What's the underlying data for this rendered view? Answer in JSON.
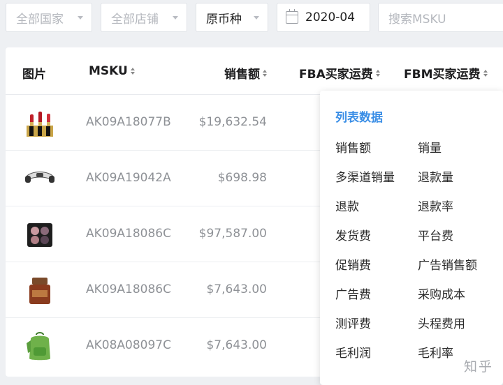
{
  "filters": {
    "country_placeholder": "全部国家",
    "store_placeholder": "全部店铺",
    "currency_value": "原币种",
    "date_value": "2020-04",
    "search_placeholder": "搜索MSKU"
  },
  "table": {
    "columns": {
      "image": "图片",
      "msku": "MSKU",
      "sales": "销售额",
      "fba_shipping": "FBA买家运费",
      "fbm_shipping": "FBM买家运费"
    },
    "rows": [
      {
        "msku": "AK09A18077B",
        "sales": "$19,632.54",
        "image_icon": "lipstick-product-icon"
      },
      {
        "msku": "AK09A19042A",
        "sales": "$698.98",
        "image_icon": "massager-product-icon"
      },
      {
        "msku": "AK09A18086C",
        "sales": "$97,587.00",
        "image_icon": "eyeshadow-product-icon"
      },
      {
        "msku": "AK09A18086C",
        "sales": "$7,643.00",
        "image_icon": "serum-bottle-product-icon"
      },
      {
        "msku": "AK08A08097C",
        "sales": "$7,643.00",
        "image_icon": "backpack-product-icon"
      }
    ]
  },
  "column_menu": {
    "title": "列表数据",
    "options": [
      [
        "销售额",
        "销量"
      ],
      [
        "多渠道销量",
        "退款量"
      ],
      [
        "退款",
        "退款率"
      ],
      [
        "发货费",
        "平台费"
      ],
      [
        "促销费",
        "广告销售额"
      ],
      [
        "广告费",
        "采购成本"
      ],
      [
        "测评费",
        "头程费用"
      ],
      [
        "毛利润",
        "毛利率"
      ]
    ]
  },
  "watermark": "知乎"
}
